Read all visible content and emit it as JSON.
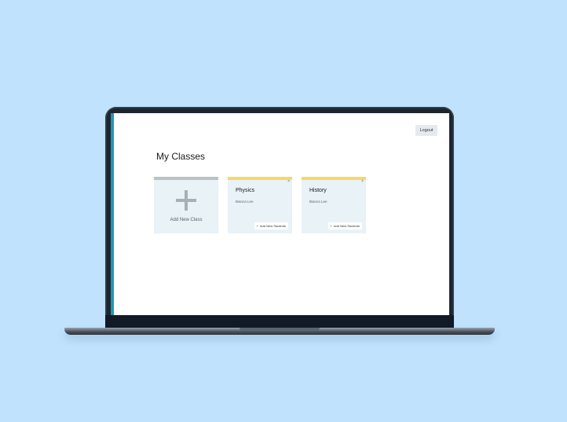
{
  "header": {
    "logout_label": "Logout"
  },
  "main": {
    "title": "My Classes",
    "add_card": {
      "label": "Add New Class",
      "icon": "plus-icon"
    },
    "classes": [
      {
        "name": "Physics",
        "teacher": "Bianca Lee",
        "close": "×",
        "add_students_label": "Add New Students",
        "add_icon": "+"
      },
      {
        "name": "History",
        "teacher": "Bianca Lee",
        "close": "×",
        "add_students_label": "Add New Students",
        "add_icon": "+"
      }
    ]
  },
  "colors": {
    "background": "#c0e2fc",
    "accent": "#1e97b3",
    "class_card_bar": "#f7d766",
    "add_card_bar": "#b9c3c6",
    "card_bg": "#e8f2f7"
  }
}
